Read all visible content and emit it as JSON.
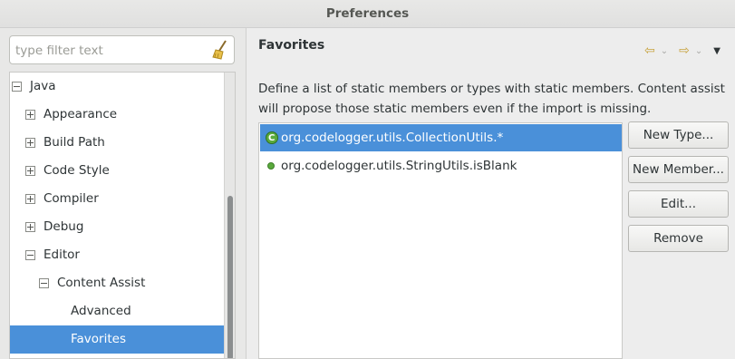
{
  "window": {
    "title": "Preferences"
  },
  "filter": {
    "placeholder": "type filter text"
  },
  "tree": {
    "items": [
      {
        "label": "Java",
        "indent": 0,
        "toggle": "minus"
      },
      {
        "label": "Appearance",
        "indent": 1,
        "toggle": "plus"
      },
      {
        "label": "Build Path",
        "indent": 1,
        "toggle": "plus"
      },
      {
        "label": "Code Style",
        "indent": 1,
        "toggle": "plus"
      },
      {
        "label": "Compiler",
        "indent": 1,
        "toggle": "plus"
      },
      {
        "label": "Debug",
        "indent": 1,
        "toggle": "plus"
      },
      {
        "label": "Editor",
        "indent": 1,
        "toggle": "minus"
      },
      {
        "label": "Content Assist",
        "indent": 2,
        "toggle": "minus"
      },
      {
        "label": "Advanced",
        "indent": 3,
        "toggle": "none"
      },
      {
        "label": "Favorites",
        "indent": 3,
        "toggle": "none",
        "selected": true
      }
    ]
  },
  "page": {
    "title": "Favorites",
    "description": "Define a list of static members or types with static members. Content assist will propose those static members even if the import is missing."
  },
  "nav": {
    "back_icon": "back-arrow-icon",
    "forward_icon": "forward-arrow-icon",
    "menu_icon": "view-menu-icon"
  },
  "favorites": {
    "items": [
      {
        "label": "org.codelogger.utils.CollectionUtils.*",
        "icon": "class-icon",
        "selected": true
      },
      {
        "label": "org.codelogger.utils.StringUtils.isBlank",
        "icon": "static-method-icon",
        "selected": false
      }
    ]
  },
  "buttons": {
    "new_type": "New Type...",
    "new_member": "New Member...",
    "edit": "Edit...",
    "remove": "Remove"
  },
  "colors": {
    "selection": "#4a90d9",
    "accent_icon": "#c7a23c"
  }
}
